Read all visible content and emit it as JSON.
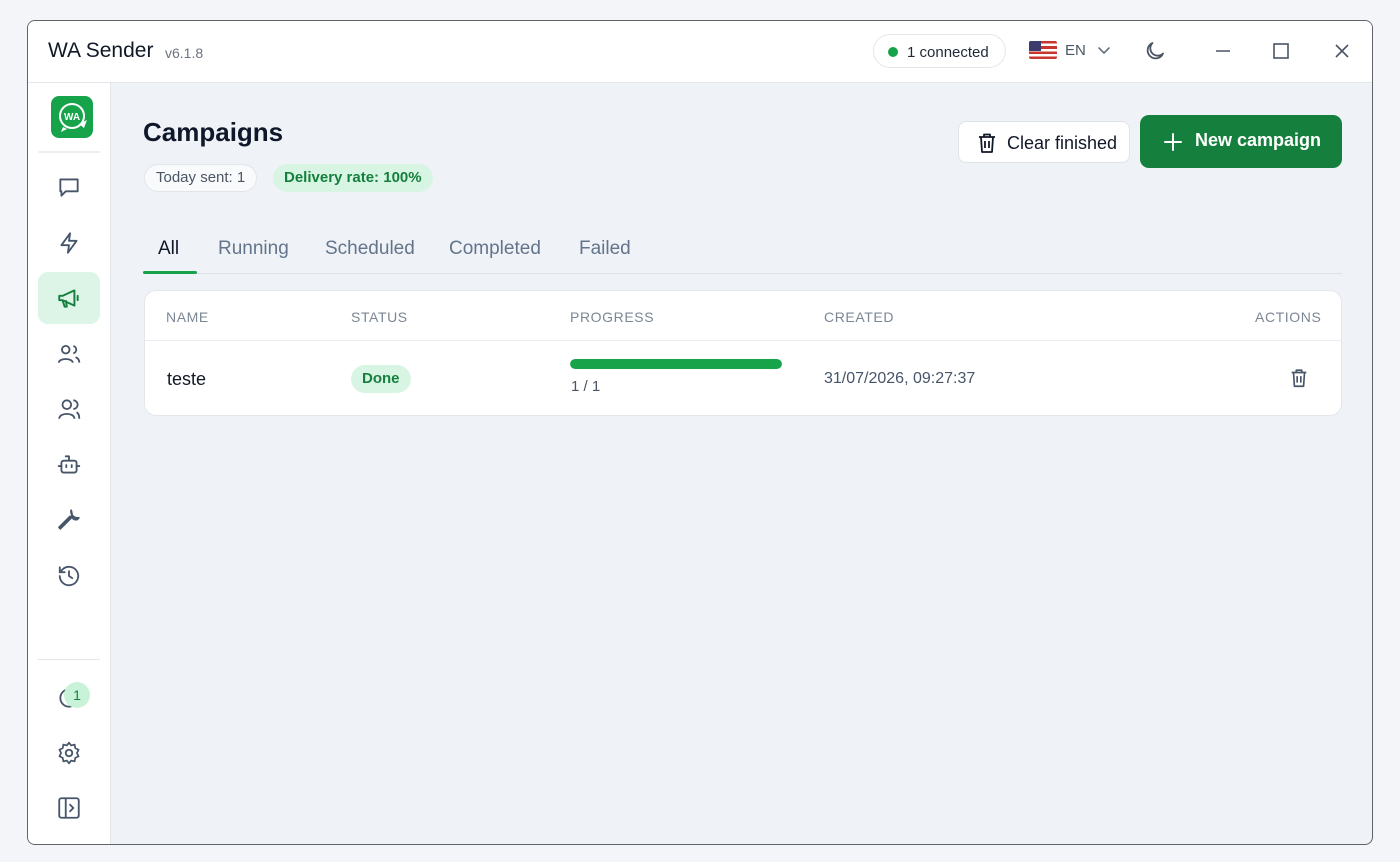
{
  "titlebar": {
    "app_name": "WA Sender",
    "version": "v6.1.8",
    "connection_status": "1 connected",
    "language": "EN",
    "icons": [
      "flag-us-icon",
      "chevron-down-icon",
      "moon-icon",
      "minimize-icon",
      "maximize-icon",
      "close-icon"
    ]
  },
  "sidebar": {
    "logo_text": "WA",
    "items": [
      {
        "name": "messages",
        "icon": "message-square-icon"
      },
      {
        "name": "quick-send",
        "icon": "zap-icon"
      },
      {
        "name": "campaigns",
        "icon": "megaphone-icon",
        "active": true
      },
      {
        "name": "contacts",
        "icon": "users-icon"
      },
      {
        "name": "groups",
        "icon": "users-alt-icon"
      },
      {
        "name": "bot",
        "icon": "bot-icon"
      },
      {
        "name": "tools",
        "icon": "wrench-icon"
      },
      {
        "name": "history",
        "icon": "history-icon"
      }
    ],
    "bottom": {
      "queue_badge": "1",
      "icons": [
        "refresh-icon",
        "gear-icon",
        "panel-toggle-icon"
      ]
    }
  },
  "page": {
    "title": "Campaigns",
    "stats": {
      "today_sent": "Today sent: 1",
      "delivery_rate": "Delivery rate: 100%"
    },
    "buttons": {
      "clear_finished": "Clear finished",
      "new_campaign": "New campaign"
    },
    "tabs": [
      {
        "label": "All",
        "active": true
      },
      {
        "label": "Running"
      },
      {
        "label": "Scheduled"
      },
      {
        "label": "Completed"
      },
      {
        "label": "Failed"
      }
    ]
  },
  "table": {
    "columns": [
      "NAME",
      "STATUS",
      "PROGRESS",
      "CREATED",
      "ACTIONS"
    ],
    "rows": [
      {
        "name": "teste",
        "status": "Done",
        "progress_text": "1 / 1",
        "progress_fraction": 1.0,
        "created": "31/07/2026, 09:27:37"
      }
    ]
  },
  "colors": {
    "accent": "#15803d",
    "accent_light": "#d8f5e3",
    "success": "#16a34a",
    "background": "#eff3f7"
  }
}
